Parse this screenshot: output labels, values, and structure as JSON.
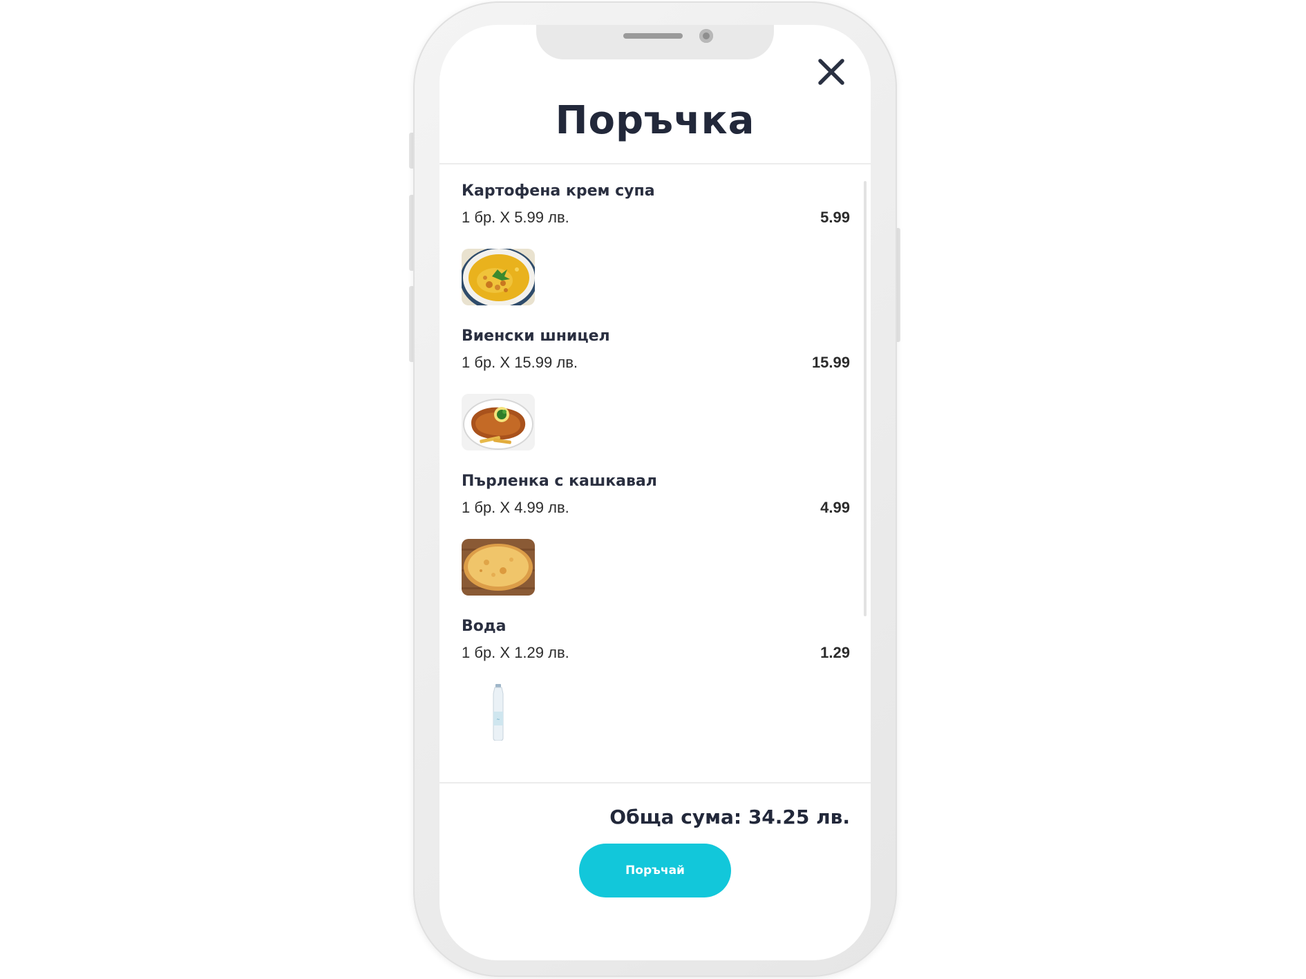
{
  "modal": {
    "title": "Поръчка",
    "close_icon": "close-icon"
  },
  "order": {
    "items": [
      {
        "name": "Картофена крем супа",
        "quantity_text": "1 бр. X 5.99 лв.",
        "total": "5.99",
        "image": "cream-soup-image"
      },
      {
        "name": "Виенски шницел",
        "quantity_text": "1 бр. X 15.99 лв.",
        "total": "15.99",
        "image": "schnitzel-image"
      },
      {
        "name": "Пърленка с кашкавал",
        "quantity_text": "1 бр. X 4.99 лв.",
        "total": "4.99",
        "image": "flatbread-image"
      },
      {
        "name": "Вода",
        "quantity_text": "1 бр. X 1.29 лв.",
        "total": "1.29",
        "image": "water-bottle-image"
      }
    ],
    "total_text": "Обща сума: 34.25 лв.",
    "submit_label": "Поръчай"
  },
  "colors": {
    "accent": "#12c7da",
    "text_dark": "#22283a"
  }
}
